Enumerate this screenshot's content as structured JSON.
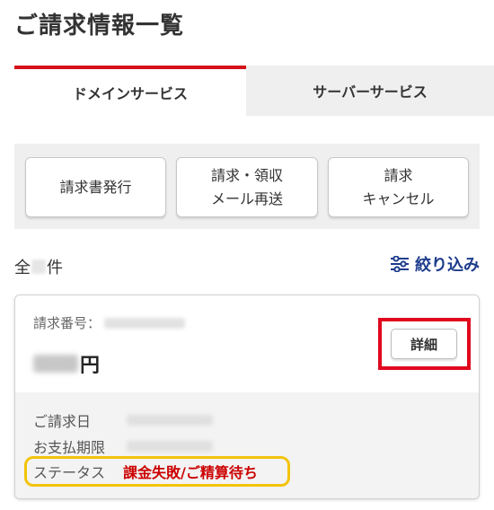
{
  "page": {
    "title": "ご請求情報一覧"
  },
  "tabs": [
    {
      "label": "ドメインサービス",
      "active": true
    },
    {
      "label": "サーバーサービス",
      "active": false
    }
  ],
  "actions": {
    "issue_invoice": "請求書発行",
    "resend_receipt": "請求・領収\nメール再送",
    "cancel_invoice": "請求\nキャンセル"
  },
  "list": {
    "count_prefix": "全",
    "count_suffix": "件",
    "filter_label": "絞り込み"
  },
  "invoice": {
    "number_label": "請求番号：",
    "amount_suffix": "円",
    "detail_button": "詳細",
    "billing_date_label": "ご請求日",
    "due_date_label": "お支払期限",
    "status_label": "ステータス",
    "status_value": "課金失敗/ご精算待ち"
  },
  "colors": {
    "accent_red": "#d5121a",
    "highlight_red": "#e1081e",
    "highlight_yellow": "#f2c40a",
    "link_blue": "#1d3c8c",
    "status_red": "#cc0000"
  }
}
